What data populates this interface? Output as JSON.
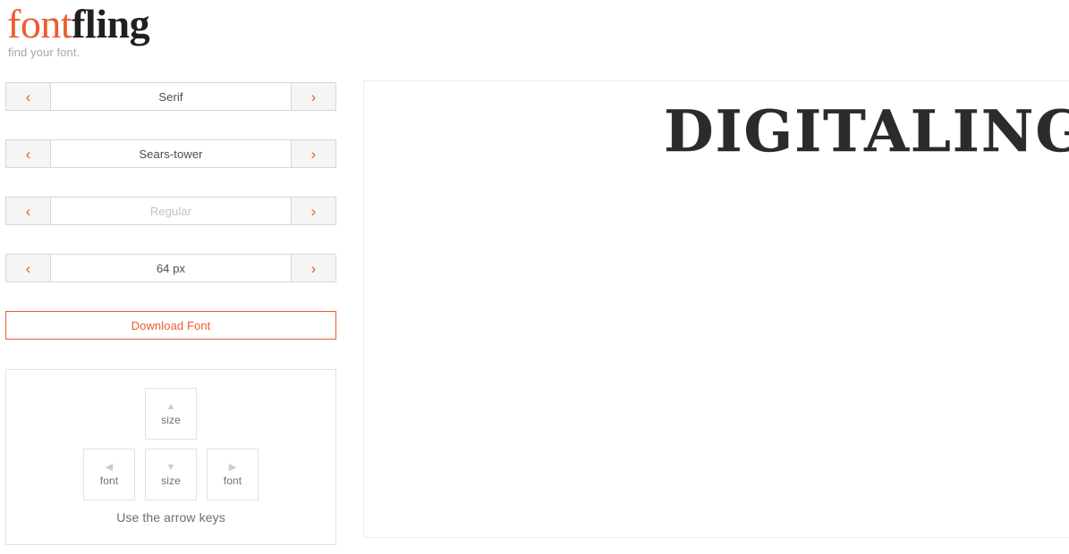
{
  "logo": {
    "part_one": "font",
    "part_two": "fling",
    "tagline": "find your font.",
    "orange": "#ed5b2e",
    "dark": "#231f20"
  },
  "selectors": [
    {
      "name": "category",
      "value": "Serif",
      "prev_icon": "‹",
      "next_icon": "›",
      "muted": false
    },
    {
      "name": "font",
      "value": "Sears-tower",
      "prev_icon": "‹",
      "next_icon": "›",
      "muted": false
    },
    {
      "name": "style",
      "value": "Regular",
      "prev_icon": "‹",
      "next_icon": "›",
      "muted": true
    },
    {
      "name": "size",
      "value": "64 px",
      "prev_icon": "‹",
      "next_icon": "›",
      "muted": false
    }
  ],
  "download": {
    "label": "Download Font",
    "accent": "#ef5b2b"
  },
  "keyboard_hint": {
    "keys": {
      "up": {
        "glyph": "▲",
        "label": "size"
      },
      "left": {
        "glyph": "◀",
        "label": "font"
      },
      "down": {
        "glyph": "▼",
        "label": "size"
      },
      "right": {
        "glyph": "▶",
        "label": "font"
      }
    },
    "caption": "Use the arrow keys"
  },
  "preview": {
    "text": "DIGITALING",
    "font_size_px": 64,
    "color": "#2b2b2b"
  }
}
